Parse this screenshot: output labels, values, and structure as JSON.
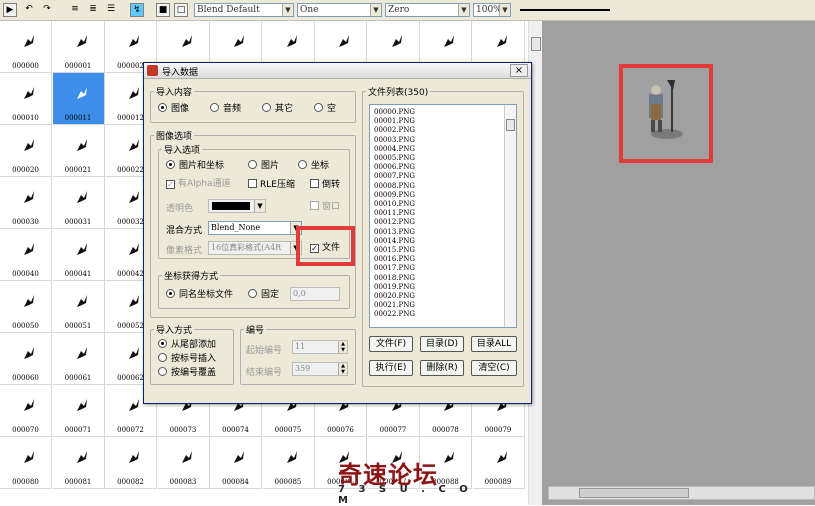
{
  "toolbar": {
    "buttons": [
      "play-icon",
      "undo-icon",
      "redo-icon",
      "align-left-icon",
      "align-center-icon",
      "list-icon",
      "marker-icon",
      "box-icon",
      "frame-icon"
    ],
    "blend_combo": "Blend Default",
    "one_combo": "One",
    "zero_combo": "Zero",
    "zoom_combo": "100%"
  },
  "grid": {
    "rows": [
      [
        "000000",
        "000001",
        "000002",
        "000003",
        "",
        "",
        "",
        "",
        "",
        ""
      ],
      [
        "000010",
        "000011",
        "000012",
        "",
        "",
        "",
        "",
        "",
        "",
        ""
      ],
      [
        "000020",
        "000021",
        "000022",
        "",
        "",
        "",
        "",
        "",
        "",
        ""
      ],
      [
        "000030",
        "000031",
        "000032",
        "",
        "",
        "",
        "",
        "",
        "",
        ""
      ],
      [
        "000040",
        "000041",
        "000042",
        "",
        "",
        "",
        "",
        "",
        "",
        ""
      ],
      [
        "000050",
        "000051",
        "000052",
        "",
        "",
        "",
        "",
        "",
        "",
        ""
      ],
      [
        "000060",
        "000061",
        "000062",
        "",
        "",
        "",
        "",
        "",
        "",
        ""
      ],
      [
        "000070",
        "000071",
        "000072",
        "000073",
        "000074",
        "000075",
        "000076",
        "000077",
        "000078",
        "000079"
      ],
      [
        "000080",
        "000081",
        "000082",
        "000083",
        "000084",
        "000085",
        "000086",
        "000087",
        "000088",
        "000089"
      ]
    ],
    "selected_index": "000011"
  },
  "watermark": {
    "title": "奇速论坛",
    "sub": "7 3 S U . C O M"
  },
  "dialog": {
    "title": "导入数据",
    "close": "×",
    "import_content": {
      "legend": "导入内容",
      "options": [
        "图像",
        "音频",
        "其它",
        "空"
      ],
      "selected": "图像"
    },
    "image_settings": {
      "legend": "图像选项",
      "import_options": {
        "legend": "导入选项",
        "radios": [
          "图片和坐标",
          "图片",
          "坐标"
        ],
        "selected": "图片和坐标",
        "alpha_check": "有Alpha通道",
        "rle_check": "RLE压缩",
        "flip_check": "倒转",
        "transparent_label": "透明色",
        "window_check": "窗口",
        "blend_label": "混合方式",
        "blend_value": "Blend_None",
        "pixel_label": "像素格式",
        "pixel_value": "16位真彩格式(A4R",
        "file_check": "文件"
      },
      "coord_source": {
        "legend": "坐标获得方式",
        "radios": [
          "同名坐标文件",
          "固定"
        ],
        "selected": "同名坐标文件",
        "fixed_value": "0,0"
      }
    },
    "import_mode": {
      "legend": "导入方式",
      "radios": [
        "从尾部添加",
        "按标号插入",
        "按编号覆盖"
      ],
      "selected": "从尾部添加"
    },
    "numbering": {
      "legend": "编号",
      "start_label": "起始编号",
      "start_value": "11",
      "end_label": "结束编号",
      "end_value": "359"
    },
    "file_list": {
      "legend": "文件列表(350)",
      "items": [
        "00000.PNG",
        "00001.PNG",
        "00002.PNG",
        "00003.PNG",
        "00004.PNG",
        "00005.PNG",
        "00006.PNG",
        "00007.PNG",
        "00008.PNG",
        "00009.PNG",
        "00010.PNG",
        "00011.PNG",
        "00012.PNG",
        "00013.PNG",
        "00014.PNG",
        "00015.PNG",
        "00016.PNG",
        "00017.PNG",
        "00018.PNG",
        "00019.PNG",
        "00020.PNG",
        "00021.PNG",
        "00022.PNG"
      ]
    },
    "buttons": {
      "file": "文件(F)",
      "dir": "目录(D)",
      "dir_all": "目录ALL",
      "exec": "执行(E)",
      "cancel": "删除(R)",
      "clear": "清空(C)"
    }
  }
}
